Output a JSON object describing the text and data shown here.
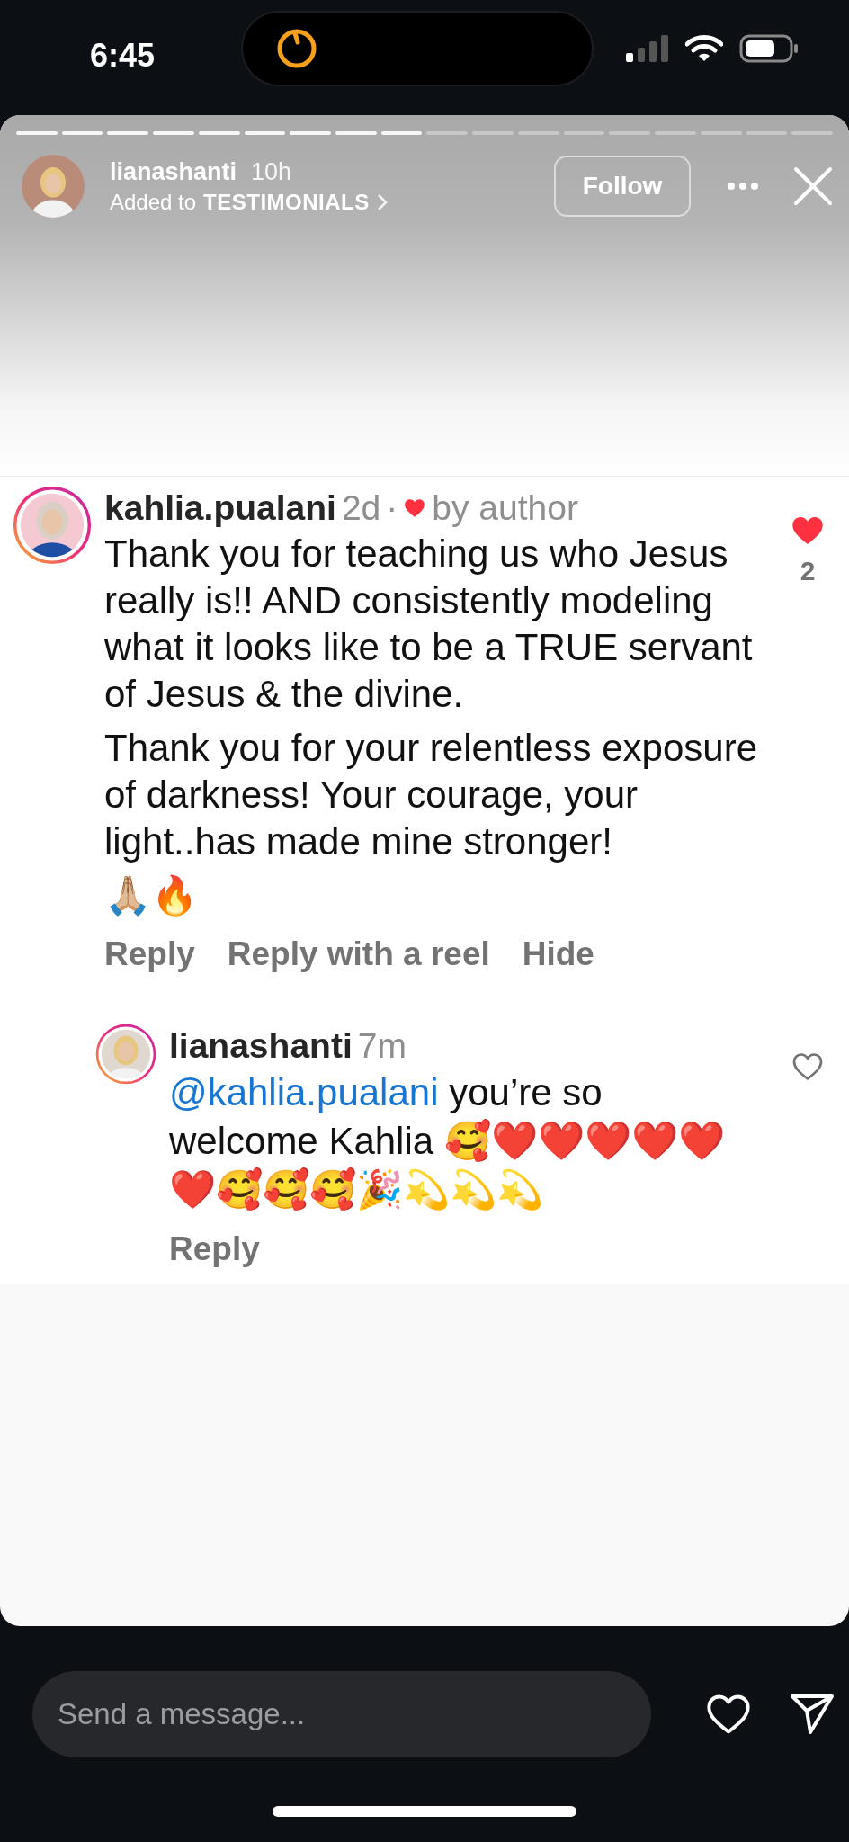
{
  "status_bar": {
    "time": "6:45"
  },
  "story": {
    "segments": [
      {
        "viewed": true
      },
      {
        "viewed": true
      },
      {
        "viewed": true
      },
      {
        "viewed": true
      },
      {
        "viewed": true
      },
      {
        "viewed": true
      },
      {
        "viewed": true
      },
      {
        "viewed": true
      },
      {
        "viewed": true
      },
      {
        "viewed": false
      },
      {
        "viewed": false
      },
      {
        "viewed": false
      },
      {
        "viewed": false
      },
      {
        "viewed": false
      },
      {
        "viewed": false
      },
      {
        "viewed": false
      },
      {
        "viewed": false
      },
      {
        "viewed": false
      }
    ],
    "username": "lianashanti",
    "time": "10h",
    "added_to_prefix": "Added to",
    "highlight": "TESTIMONIALS",
    "follow_button": "Follow"
  },
  "comment": {
    "username": "kahlia.pualani",
    "time": "2d",
    "separator": "·",
    "author_like_label": "by author",
    "liked": true,
    "like_count": "2",
    "paragraphs": [
      "Thank you for teaching us who Jesus really is!! AND consistently modeling what it looks like to be a TRUE servant of Jesus & the divine.",
      "Thank you for your relentless exposure of darkness! Your courage, your light..has made mine stronger!",
      "🙏🏼🔥"
    ],
    "actions": [
      "Reply",
      "Reply with a reel",
      "Hide"
    ]
  },
  "reply": {
    "username": "lianashanti",
    "time": "7m",
    "liked": false,
    "mention": "@kahlia.pualani",
    "text": "you’re so welcome Kahlia 🥰❤️❤️❤️❤️❤️❤️🥰🥰🥰🎉💫💫💫",
    "actions": [
      "Reply"
    ]
  },
  "message_bar": {
    "placeholder": "Send a message..."
  }
}
